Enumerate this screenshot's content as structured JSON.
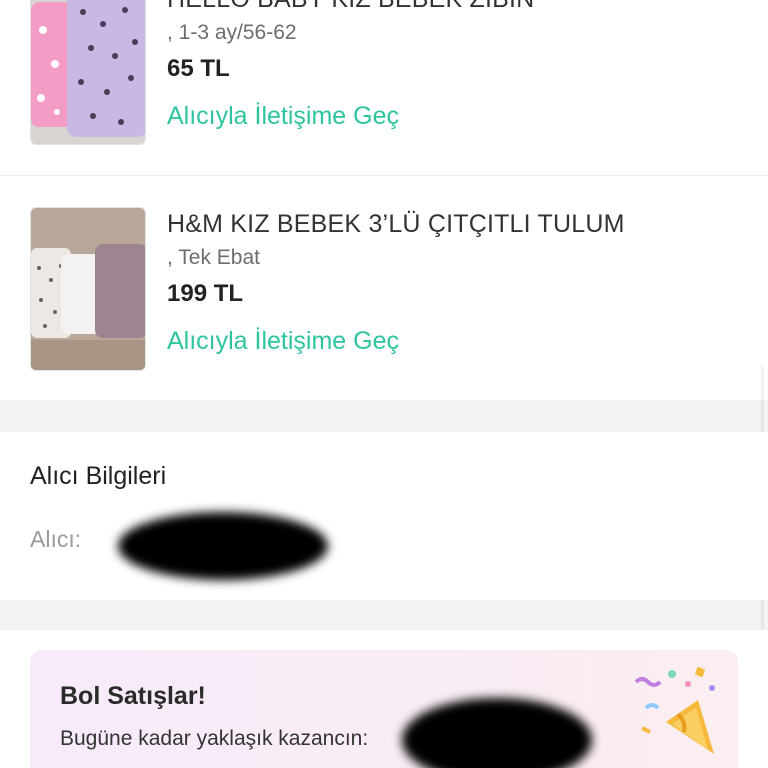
{
  "items": [
    {
      "title": "HELLO BABY KIZ BEBEK ZIBIN",
      "size": ", 1-3 ay/56-62",
      "price": "65 TL",
      "contact_label": "Alıcıyla İletişime Geç"
    },
    {
      "title": "H&M KIZ BEBEK 3’LÜ ÇITÇITLI TULUM",
      "size": ", Tek Ebat",
      "price": "199 TL",
      "contact_label": "Alıcıyla İletişime Geç"
    }
  ],
  "buyer": {
    "section_title": "Alıcı Bilgileri",
    "label": "Alıcı:"
  },
  "promo": {
    "title": "Bol Satışlar!",
    "text": "Bugüne kadar yaklaşık kazancın:"
  },
  "colors": {
    "accent": "#2ec4a0",
    "promo_bg": "#f7ebfa",
    "price": "#222222"
  },
  "icons": [
    "party-popper-icon"
  ]
}
